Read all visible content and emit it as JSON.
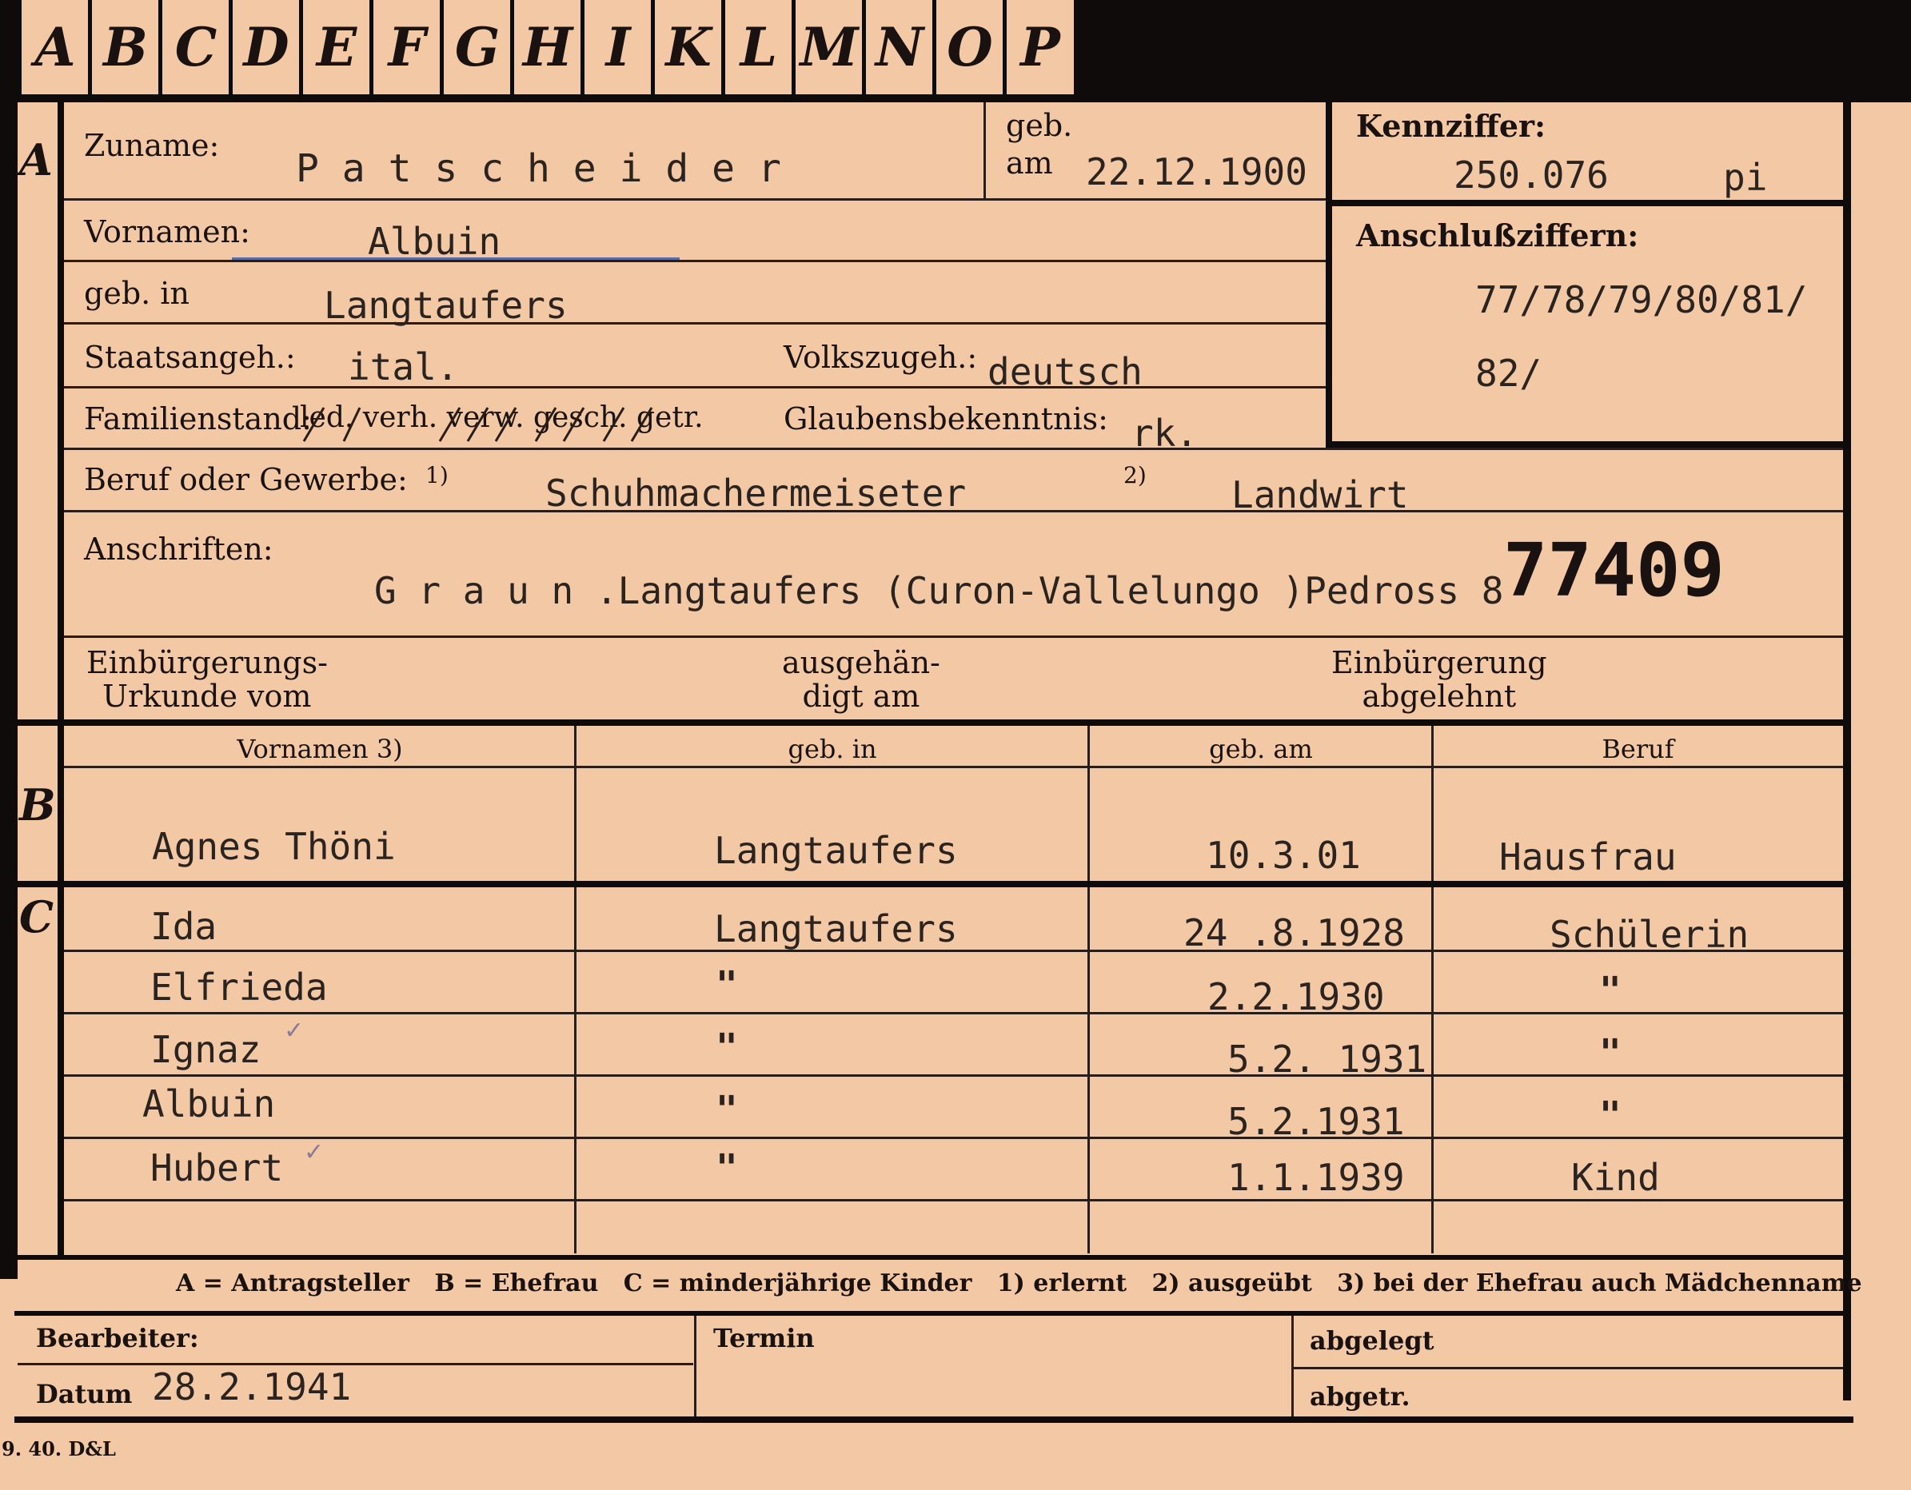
{
  "tabs": [
    "A",
    "B",
    "C",
    "D",
    "E",
    "F",
    "G",
    "H",
    "I",
    "K",
    "L",
    "M",
    "N",
    "O",
    "P"
  ],
  "section_a": {
    "marker": "A",
    "surname_label": "Zuname:",
    "surname": "P a t s c h e i d e r",
    "born_label_top": "geb.",
    "born_label_bottom": "am",
    "born_date": "22.12.1900",
    "kennziffer_label": "Kennziffer:",
    "kennziffer": "250.076",
    "kennziffer_suffix": "pi",
    "firstnames_label": "Vornamen:",
    "firstnames": "Albuin",
    "anschluss_label": "Anschlußziffern:",
    "anschluss_line1": "77/78/79/80/81/",
    "anschluss_line2": "82/",
    "birthplace_label": "geb. in",
    "birthplace": "Langtaufers",
    "citizenship_label": "Staatsangeh.:",
    "citizenship": "ital.",
    "ethnicity_label": "Volkszugeh.:",
    "ethnicity": "deutsch",
    "marital_label": "Familienstand:",
    "marital_options": "led. verh. verw. gesch. getr.",
    "religion_label": "Glaubensbekenntnis:",
    "religion": "rk.",
    "occupation_label": "Beruf oder Gewerbe:",
    "occupation_mark1": "1)",
    "occupation1": "Schuhmachermeiseter",
    "occupation_mark2": "2)",
    "occupation2": "Landwirt",
    "address_label": "Anschriften:",
    "address": "G r a u n .Langtaufers (Curon-Vallelungo )Pedross 8",
    "stamp_number": "77409",
    "naturalization_doc_label_1": "Einbürgerungs-",
    "naturalization_doc_label_2": "Urkunde vom",
    "handed_label_1": "ausgehän-",
    "handed_label_2": "digt am",
    "rejected_label_1": "Einbürgerung",
    "rejected_label_2": "abgelehnt"
  },
  "table_headers": {
    "firstnames": "Vornamen 3)",
    "born_in": "geb. in",
    "born_on": "geb. am",
    "occupation": "Beruf"
  },
  "section_b": {
    "marker": "B",
    "name": "Agnes Thöni",
    "born_in": "Langtaufers",
    "born_on": "10.3.01",
    "occupation": "Hausfrau"
  },
  "section_c": {
    "marker": "C",
    "rows": [
      {
        "name": "Ida",
        "born_in": "Langtaufers",
        "born_on": "24 .8.1928",
        "occupation": "Schülerin",
        "tick": ""
      },
      {
        "name": "Elfrieda",
        "born_in": "\"",
        "born_on": "2.2.1930",
        "occupation": "\"",
        "tick": ""
      },
      {
        "name": "Ignaz",
        "born_in": "\"",
        "born_on": "5.2. 1931",
        "occupation": "\"",
        "tick": "✓"
      },
      {
        "name": "Albuin",
        "born_in": "\"",
        "born_on": "5.2.1931",
        "occupation": "\"",
        "tick": ""
      },
      {
        "name": "Hubert",
        "born_in": "\"",
        "born_on": "1.1.1939",
        "occupation": "Kind",
        "tick": "✓"
      }
    ]
  },
  "legend": "A = Antragsteller   B = Ehefrau   C = minderjährige Kinder   1) erlernt   2) ausgeübt   3) bei der Ehefrau auch Mädchenname",
  "footer": {
    "clerk_label": "Bearbeiter:",
    "date_label": "Datum",
    "date": "28.2.1941",
    "deadline_label": "Termin",
    "filed_label": "abgelegt",
    "removed_label": "abgetr."
  },
  "print_mark": "9. 40. D&L"
}
